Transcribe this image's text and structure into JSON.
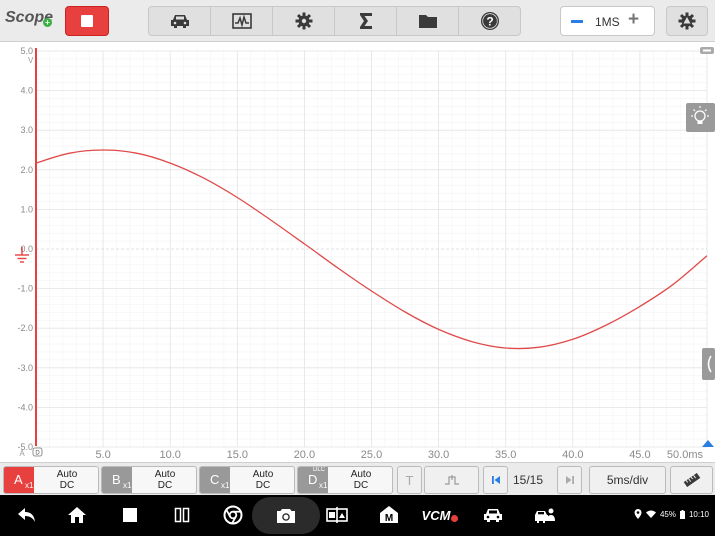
{
  "topbar": {
    "app_title": "Scope",
    "timebase_value": "1MS",
    "tools": [
      "car-icon",
      "waveform-icon",
      "gear-icon",
      "sigma-icon",
      "folder-icon",
      "help-icon"
    ]
  },
  "plot": {
    "y_ticks": [
      "5.0",
      "4.0",
      "3.0",
      "2.0",
      "1.0",
      "0.0",
      "-1.0",
      "-2.0",
      "-3.0",
      "-4.0",
      "-5.0"
    ],
    "y_unit": "V",
    "x_ticks": [
      "5.0",
      "10.0",
      "15.0",
      "20.0",
      "25.0",
      "30.0",
      "35.0",
      "40.0",
      "45.0"
    ],
    "x_end_label": "50.0ms",
    "channel_marker": "A",
    "trace_color": "#e04a4a",
    "accent_color": "#e8403f"
  },
  "chart_data": {
    "type": "line",
    "xlim": [
      0,
      50
    ],
    "ylim": [
      -5,
      5
    ],
    "xlabel": "ms",
    "ylabel": "V",
    "grid": true,
    "series": [
      {
        "x": [
          0,
          2.5,
          5,
          7.5,
          10,
          12.5,
          15,
          17.5,
          20,
          22.5,
          25,
          27.5,
          30,
          32.5,
          35,
          37.5,
          40,
          42.5,
          45,
          47.5,
          50
        ],
        "values": [
          2.17,
          2.42,
          2.5,
          2.42,
          2.17,
          1.79,
          1.3,
          0.73,
          0.13,
          -0.48,
          -1.06,
          -1.59,
          -2.03,
          -2.34,
          -2.5,
          -2.48,
          -2.28,
          -1.92,
          -1.45,
          -0.89,
          -0.17
        ]
      }
    ]
  },
  "channels": [
    {
      "letter": "A",
      "scale": "x1",
      "mode": "Auto",
      "coupling": "DC",
      "color": "#e8403f",
      "tag": ""
    },
    {
      "letter": "B",
      "scale": "x1",
      "mode": "Auto",
      "coupling": "DC",
      "color": "#999999",
      "tag": ""
    },
    {
      "letter": "C",
      "scale": "x1",
      "mode": "Auto",
      "coupling": "DC",
      "color": "#999999",
      "tag": ""
    },
    {
      "letter": "D",
      "scale": "x1",
      "mode": "Auto",
      "coupling": "DC",
      "color": "#999999",
      "tag": "DLC"
    }
  ],
  "bottombar": {
    "page": "15/15",
    "time_div": "5ms/div",
    "accent": "#2a7de1"
  },
  "navbar": {
    "battery": "45%",
    "time": "10:10",
    "vcm_label": "VCM"
  }
}
